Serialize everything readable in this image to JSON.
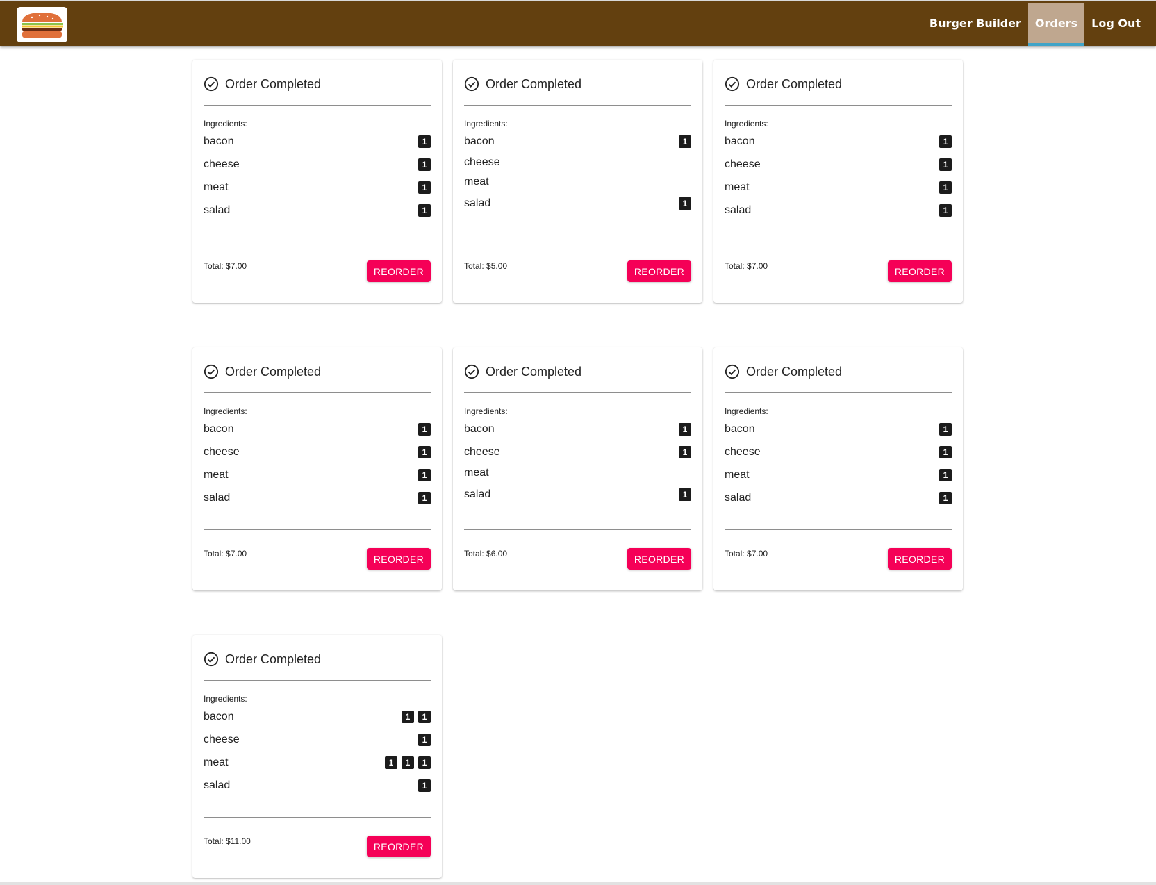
{
  "nav": {
    "logo_alt": "burger-logo-icon",
    "items": [
      {
        "label": "Burger Builder",
        "active": false
      },
      {
        "label": "Orders",
        "active": true
      },
      {
        "label": "Log Out",
        "active": false
      }
    ]
  },
  "colors": {
    "navbar": "#63400f",
    "active_tab": "#bfa78f",
    "active_underline": "#40a4c8",
    "reorder": "#f50057",
    "badge": "#1c1c1c"
  },
  "orders": [
    {
      "title": "Order Completed",
      "ingredients_label": "Ingredients:",
      "ingredients": [
        {
          "name": "bacon",
          "badges": [
            "1"
          ]
        },
        {
          "name": "cheese",
          "badges": [
            "1"
          ]
        },
        {
          "name": "meat",
          "badges": [
            "1"
          ]
        },
        {
          "name": "salad",
          "badges": [
            "1"
          ]
        }
      ],
      "total": "Total: $7.00",
      "reorder_label": "REORDER"
    },
    {
      "title": "Order Completed",
      "ingredients_label": "Ingredients:",
      "ingredients": [
        {
          "name": "bacon",
          "badges": [
            "1"
          ]
        },
        {
          "name": "cheese",
          "badges": []
        },
        {
          "name": "meat",
          "badges": []
        },
        {
          "name": "salad",
          "badges": [
            "1"
          ]
        }
      ],
      "total": "Total: $5.00",
      "reorder_label": "REORDER"
    },
    {
      "title": "Order Completed",
      "ingredients_label": "Ingredients:",
      "ingredients": [
        {
          "name": "bacon",
          "badges": [
            "1"
          ]
        },
        {
          "name": "cheese",
          "badges": [
            "1"
          ]
        },
        {
          "name": "meat",
          "badges": [
            "1"
          ]
        },
        {
          "name": "salad",
          "badges": [
            "1"
          ]
        }
      ],
      "total": "Total: $7.00",
      "reorder_label": "REORDER"
    },
    {
      "title": "Order Completed",
      "ingredients_label": "Ingredients:",
      "ingredients": [
        {
          "name": "bacon",
          "badges": [
            "1"
          ]
        },
        {
          "name": "cheese",
          "badges": [
            "1"
          ]
        },
        {
          "name": "meat",
          "badges": [
            "1"
          ]
        },
        {
          "name": "salad",
          "badges": [
            "1"
          ]
        }
      ],
      "total": "Total: $7.00",
      "reorder_label": "REORDER"
    },
    {
      "title": "Order Completed",
      "ingredients_label": "Ingredients:",
      "ingredients": [
        {
          "name": "bacon",
          "badges": [
            "1"
          ]
        },
        {
          "name": "cheese",
          "badges": [
            "1"
          ]
        },
        {
          "name": "meat",
          "badges": []
        },
        {
          "name": "salad",
          "badges": [
            "1"
          ]
        }
      ],
      "total": "Total: $6.00",
      "reorder_label": "REORDER"
    },
    {
      "title": "Order Completed",
      "ingredients_label": "Ingredients:",
      "ingredients": [
        {
          "name": "bacon",
          "badges": [
            "1"
          ]
        },
        {
          "name": "cheese",
          "badges": [
            "1"
          ]
        },
        {
          "name": "meat",
          "badges": [
            "1"
          ]
        },
        {
          "name": "salad",
          "badges": [
            "1"
          ]
        }
      ],
      "total": "Total: $7.00",
      "reorder_label": "REORDER"
    },
    {
      "title": "Order Completed",
      "ingredients_label": "Ingredients:",
      "ingredients": [
        {
          "name": "bacon",
          "badges": [
            "1",
            "1"
          ]
        },
        {
          "name": "cheese",
          "badges": [
            "1"
          ]
        },
        {
          "name": "meat",
          "badges": [
            "1",
            "1",
            "1"
          ]
        },
        {
          "name": "salad",
          "badges": [
            "1"
          ]
        }
      ],
      "total": "Total: $11.00",
      "reorder_label": "REORDER"
    }
  ]
}
